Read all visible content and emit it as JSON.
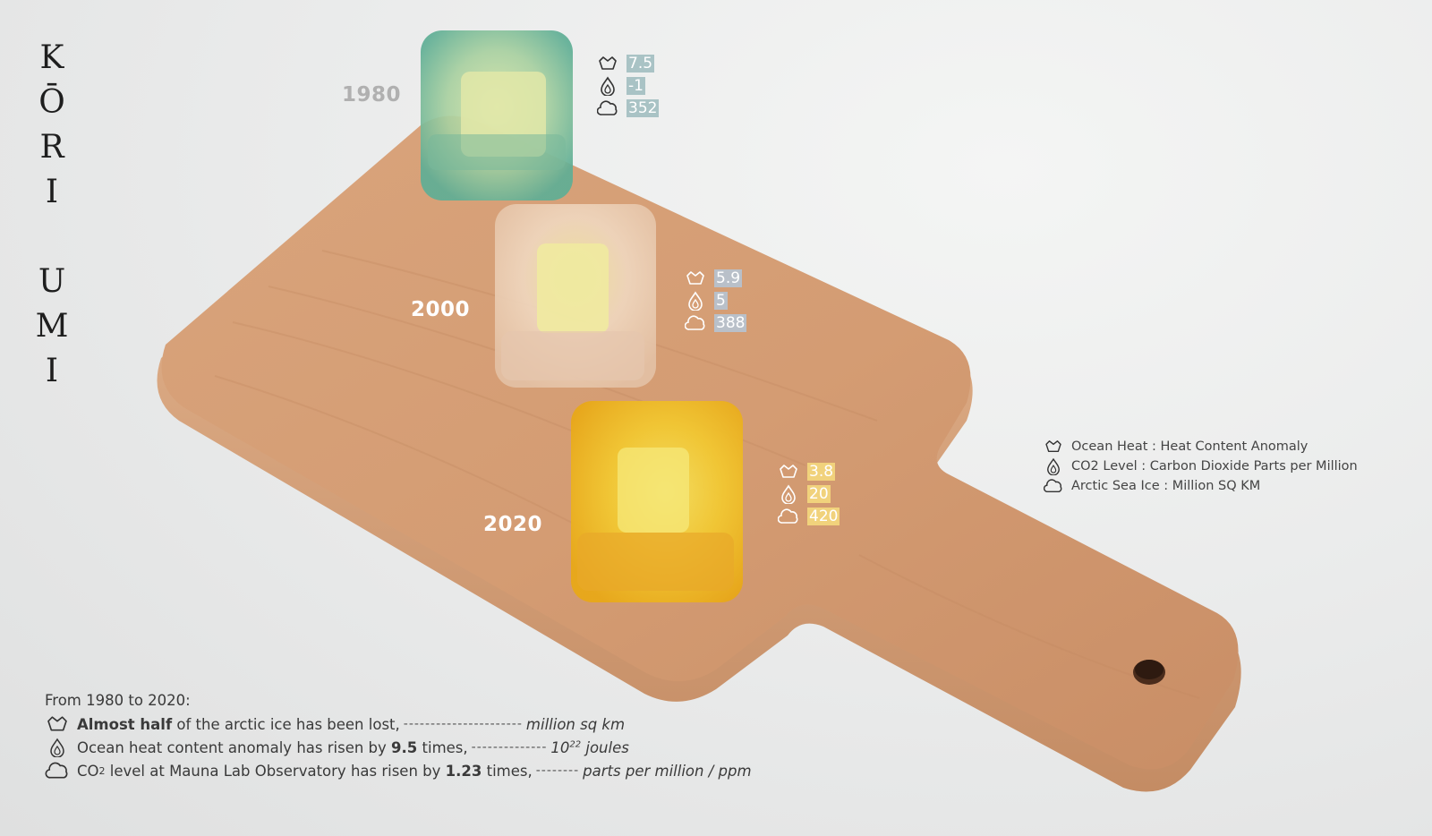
{
  "title_letters": [
    "K",
    "Ō",
    "R",
    "I",
    "",
    "U",
    "M",
    "I"
  ],
  "colors": {
    "y1980_label": "#b0b0b0",
    "y1980_value_bg": "#a9c3c5",
    "y2000_label": "#ffffff",
    "y2000_value_bg": "#b9c0c9",
    "y2020_label": "#ffffff",
    "y2020_value_bg": "#f1d27c"
  },
  "years": [
    {
      "year": "1980",
      "ocean_heat": "7.5",
      "co2": "-1",
      "arctic_ice": "352"
    },
    {
      "year": "2000",
      "ocean_heat": "5.9",
      "co2": "5",
      "arctic_ice": "388"
    },
    {
      "year": "2020",
      "ocean_heat": "3.8",
      "co2": "20",
      "arctic_ice": "420"
    }
  ],
  "legend": [
    {
      "icon": "ice-crown-icon",
      "label": "Ocean Heat",
      "desc": "Heat Content Anomaly"
    },
    {
      "icon": "water-drop-icon",
      "label": "CO2 Level",
      "desc": "Carbon Dioxide Parts per Million"
    },
    {
      "icon": "cloud-icon",
      "label": "Arctic Sea Ice",
      "desc": "Million SQ KM"
    }
  ],
  "summary": {
    "intro": "From 1980 to 2020:",
    "line1": {
      "bold": "Almost half",
      "text": "of the arctic ice has been lost,",
      "dashes": "----------------------",
      "unit": "million sq km"
    },
    "line2": {
      "text_a": "Ocean heat content anomaly has risen by",
      "bold": "9.5",
      "text_b": "times,",
      "dashes": "--------------",
      "unit_base": "10",
      "unit_exp": "22",
      "unit_rest": "joules"
    },
    "line3": {
      "text_a": "CO",
      "sub": "2",
      "text_b": "level at Mauna Lab Observatory has risen by",
      "bold": "1.23",
      "text_c": "times,",
      "dashes": "--------",
      "unit": "parts per million / ppm"
    }
  }
}
